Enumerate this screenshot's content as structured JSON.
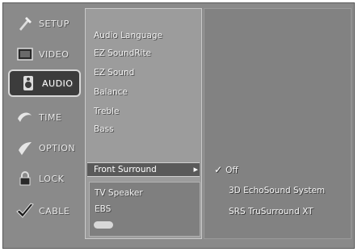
{
  "nav": {
    "items": [
      {
        "label": "SETUP",
        "icon": "setup-icon"
      },
      {
        "label": "VIDEO",
        "icon": "video-icon"
      },
      {
        "label": "AUDIO",
        "icon": "audio-icon",
        "active": true
      },
      {
        "label": "TIME",
        "icon": "time-icon"
      },
      {
        "label": "OPTION",
        "icon": "option-icon"
      },
      {
        "label": "LOCK",
        "icon": "lock-icon"
      },
      {
        "label": "CABLE",
        "icon": "cable-icon"
      }
    ]
  },
  "menu": {
    "items": [
      "Audio Language",
      "EZ SoundRite",
      "EZ Sound",
      "Balance",
      "Treble",
      "Bass"
    ],
    "selected": "Front Surround",
    "lower_items": [
      "TV Speaker",
      "EBS"
    ]
  },
  "options": {
    "items": [
      {
        "label": "Off",
        "checked": true
      },
      {
        "label": "3D EchoSound System",
        "checked": false
      },
      {
        "label": "SRS TruSurround XT",
        "checked": false
      }
    ]
  },
  "colors": {
    "panel": "#9c9c9c",
    "panel_dark": "#828282",
    "frame": "#8a8a8a"
  }
}
